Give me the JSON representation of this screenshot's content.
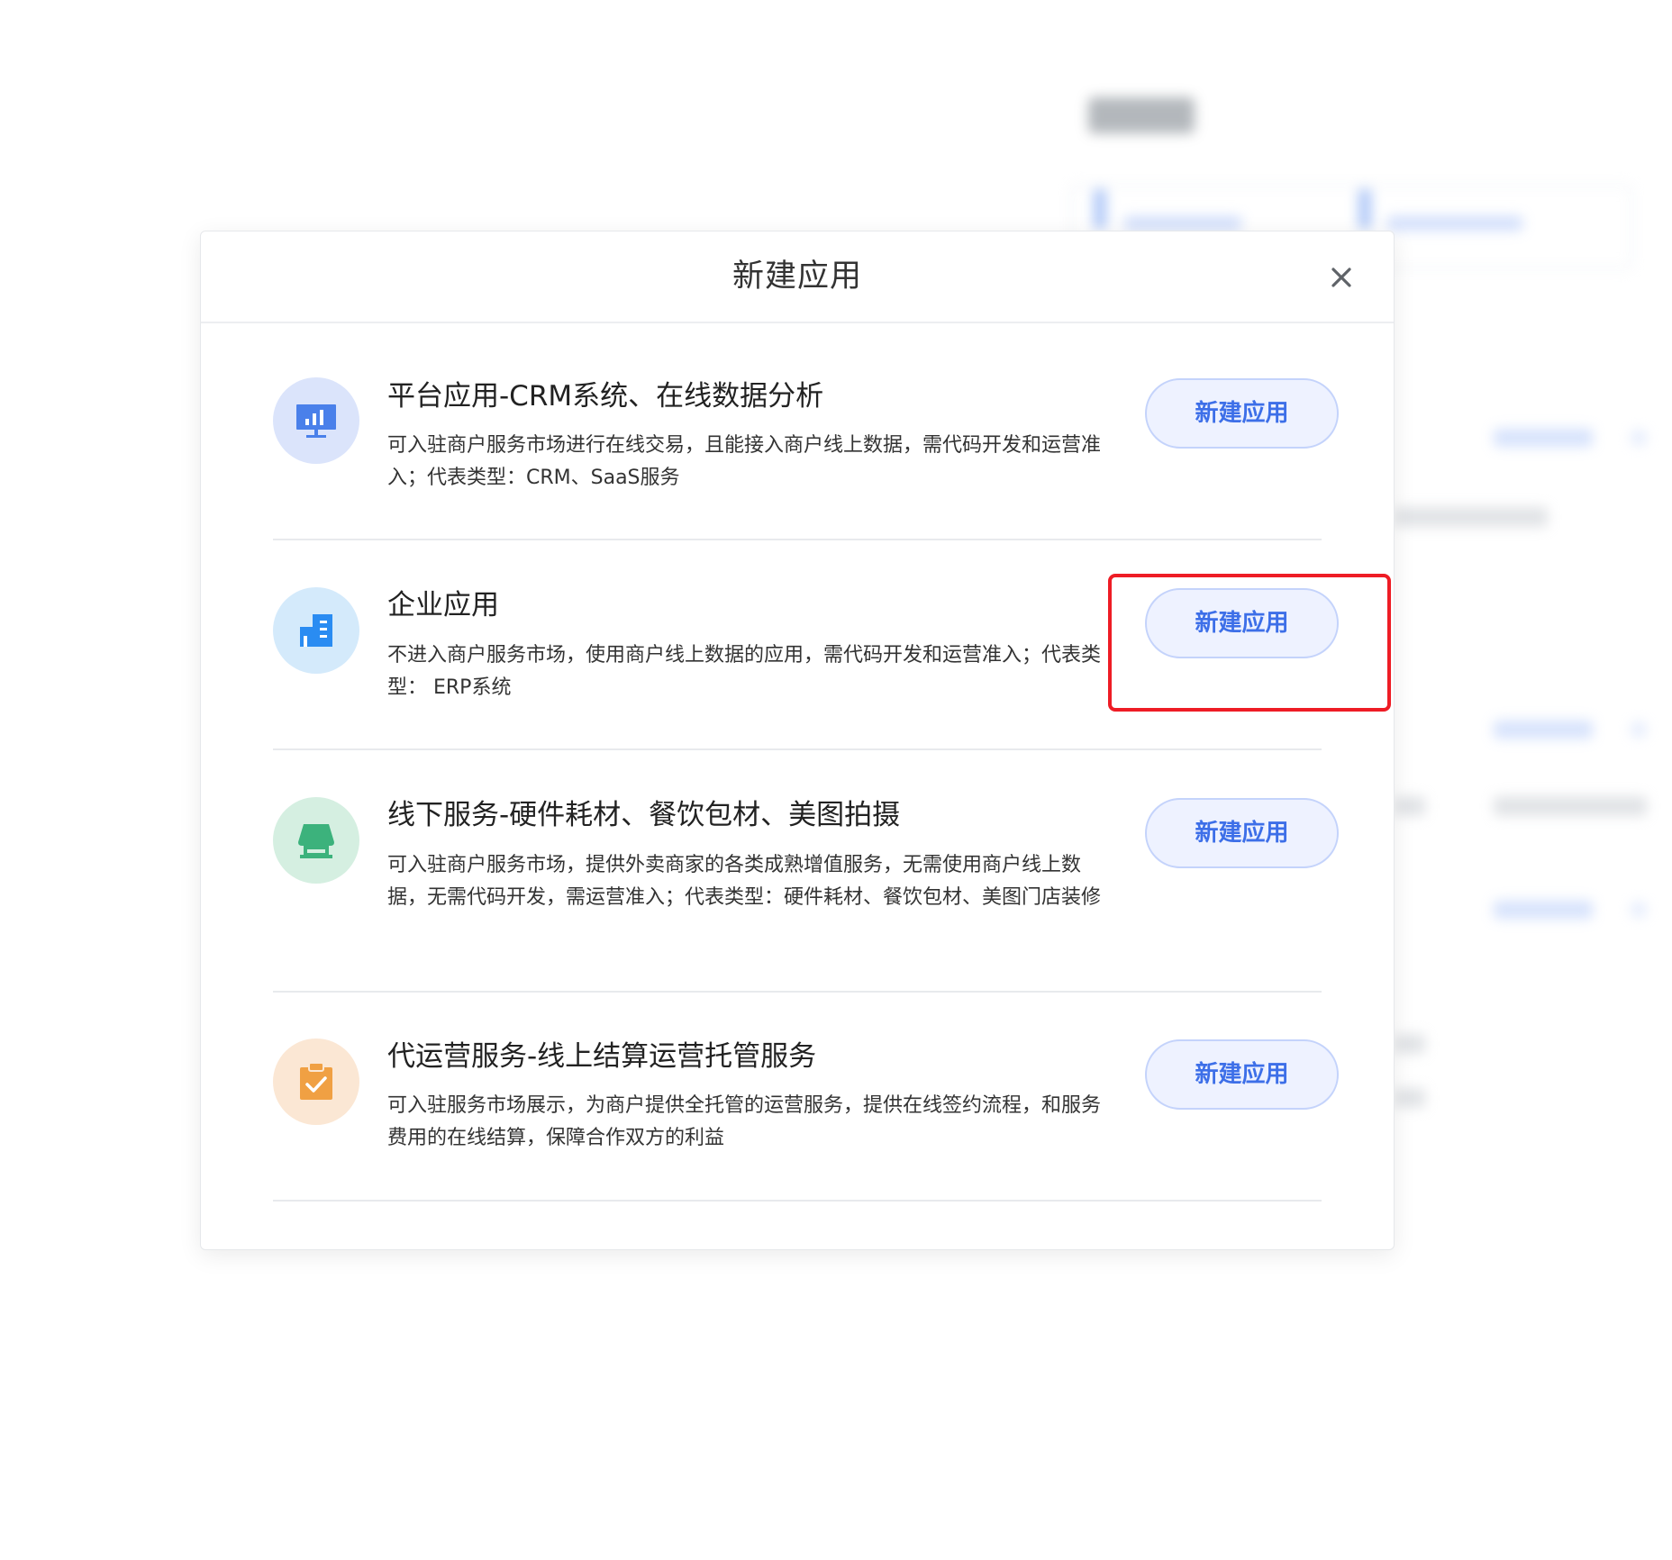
{
  "modal": {
    "title": "新建应用",
    "close_icon": "close-icon"
  },
  "options": [
    {
      "icon": "chart-monitor-icon",
      "icon_color": "#4a80ea",
      "icon_bg": "#dbe4fb",
      "title": "平台应用-CRM系统、在线数据分析",
      "desc": "可入驻商户服务市场进行在线交易，且能接入商户线上数据，需代码开发和运营准入；代表类型：CRM、SaaS服务",
      "button": "新建应用"
    },
    {
      "icon": "building-icon",
      "icon_color": "#2a8cf2",
      "icon_bg": "#d4eafb",
      "title": "企业应用",
      "desc": "不进入商户服务市场，使用商户线上数据的应用，需代码开发和运营准入；代表类型： ERP系统",
      "button": "新建应用"
    },
    {
      "icon": "storefront-icon",
      "icon_color": "#3cb27c",
      "icon_bg": "#d5efe1",
      "title": "线下服务-硬件耗材、餐饮包材、美图拍摄",
      "desc": "可入驻商户服务市场，提供外卖商家的各类成熟增值服务，无需使用商户线上数据，无需代码开发，需运营准入；代表类型：硬件耗材、餐饮包材、美图门店装修",
      "button": "新建应用"
    },
    {
      "icon": "clipboard-check-icon",
      "icon_color": "#f0a043",
      "icon_bg": "#fbe7d4",
      "title": "代运营服务-线上结算运营托管服务",
      "desc": "可入驻服务市场展示，为商户提供全托管的运营服务，提供在线签约流程，和服务费用的在线结算，保障合作双方的利益",
      "button": "新建应用"
    }
  ],
  "colors": {
    "accent": "#3d6fe8",
    "button_bg": "#eef2ff",
    "button_border": "#c4d3fb",
    "highlight": "#ee1c25"
  }
}
